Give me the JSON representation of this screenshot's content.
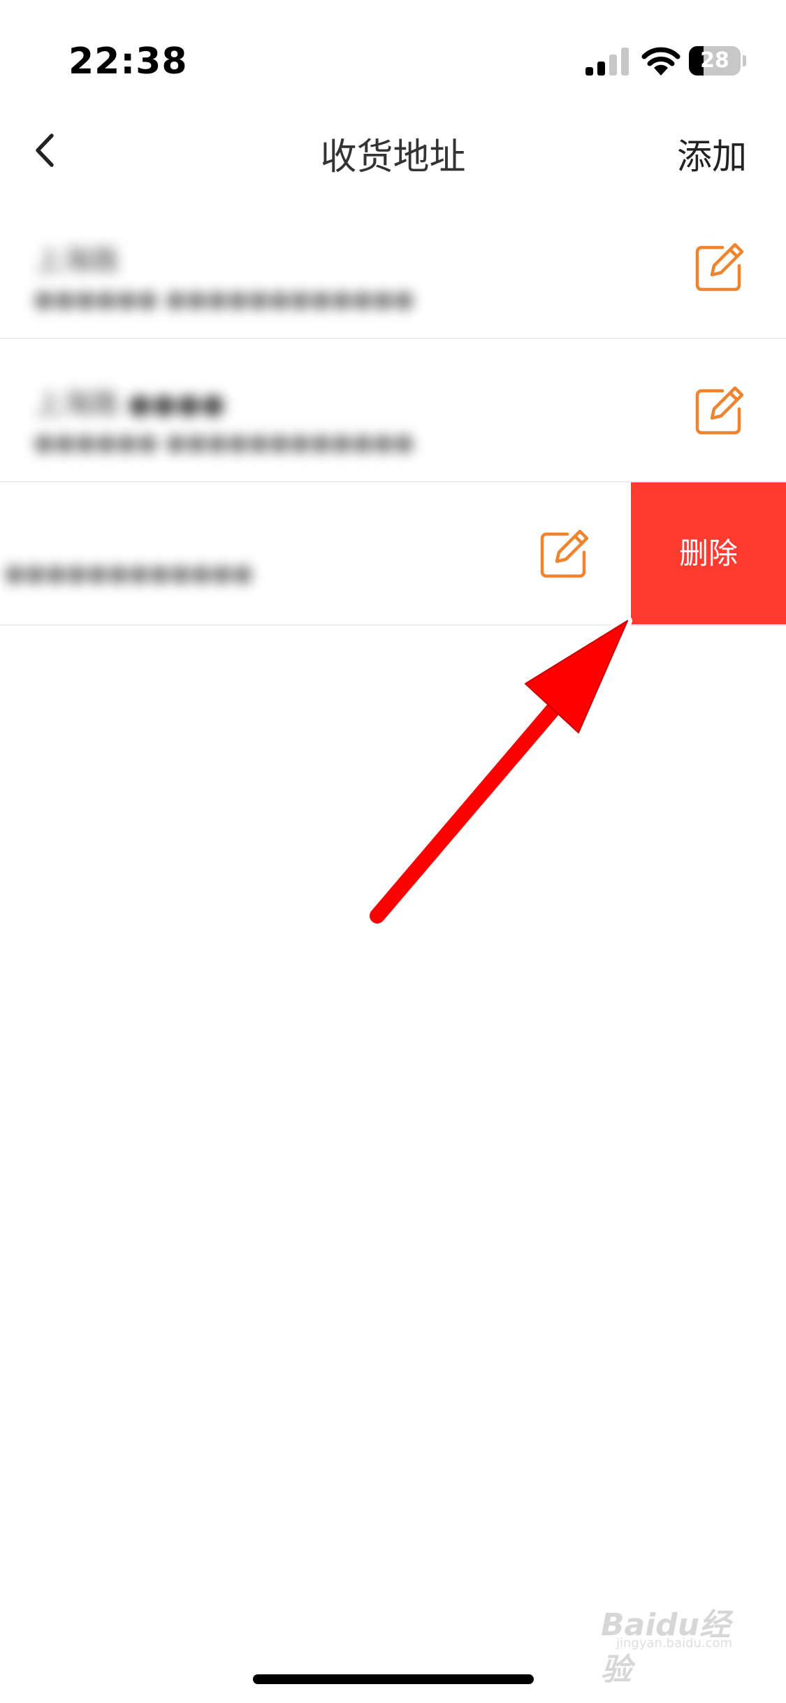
{
  "status_bar": {
    "time": "22:38",
    "battery_level": "28",
    "battery_fraction": 0.28
  },
  "nav": {
    "title": "收货地址",
    "add_label": "添加"
  },
  "addresses": [
    {
      "name": "上海路",
      "detail": "●●●●●●  ●●●●●●●●●●●●"
    },
    {
      "name": "上海路 ●●●●",
      "detail": "●●●●●●  ●●●●●●●●●●●●"
    },
    {
      "name": "",
      "detail": "●●●●●●●●●●●●"
    }
  ],
  "row_actions": {
    "delete_label": "删除"
  },
  "watermark": {
    "text": "Baidu经验",
    "sub": "jingyan.baidu.com"
  },
  "colors": {
    "accent_orange": "#f0842e",
    "delete_red": "#ff3b30",
    "annotation_red": "#ff0000"
  }
}
